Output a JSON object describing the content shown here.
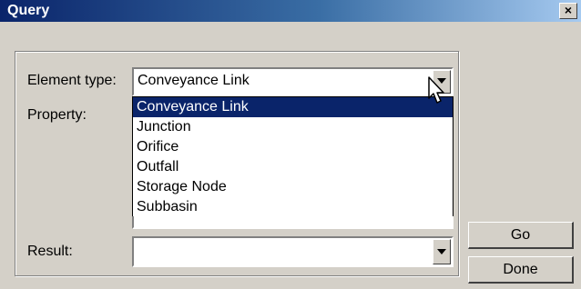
{
  "window": {
    "title": "Query",
    "close_glyph": "×"
  },
  "form": {
    "element_type_label": "Element type:",
    "element_type_value": "Conveyance Link",
    "property_label": "Property:",
    "result_label": "Result:",
    "result_value": ""
  },
  "dropdown": {
    "options": [
      "Conveyance Link",
      "Junction",
      "Orifice",
      "Outfall",
      "Storage Node",
      "Subbasin"
    ],
    "selected_index": 0
  },
  "buttons": {
    "go": "Go",
    "done": "Done"
  },
  "colors": {
    "face": "#d4d0c8",
    "title_start": "#0a246a",
    "title_end": "#a6caf0",
    "selection": "#0a246a"
  },
  "icons": {
    "close": "close-icon",
    "dropdown": "chevron-down-icon",
    "cursor": "mouse-pointer-icon"
  }
}
